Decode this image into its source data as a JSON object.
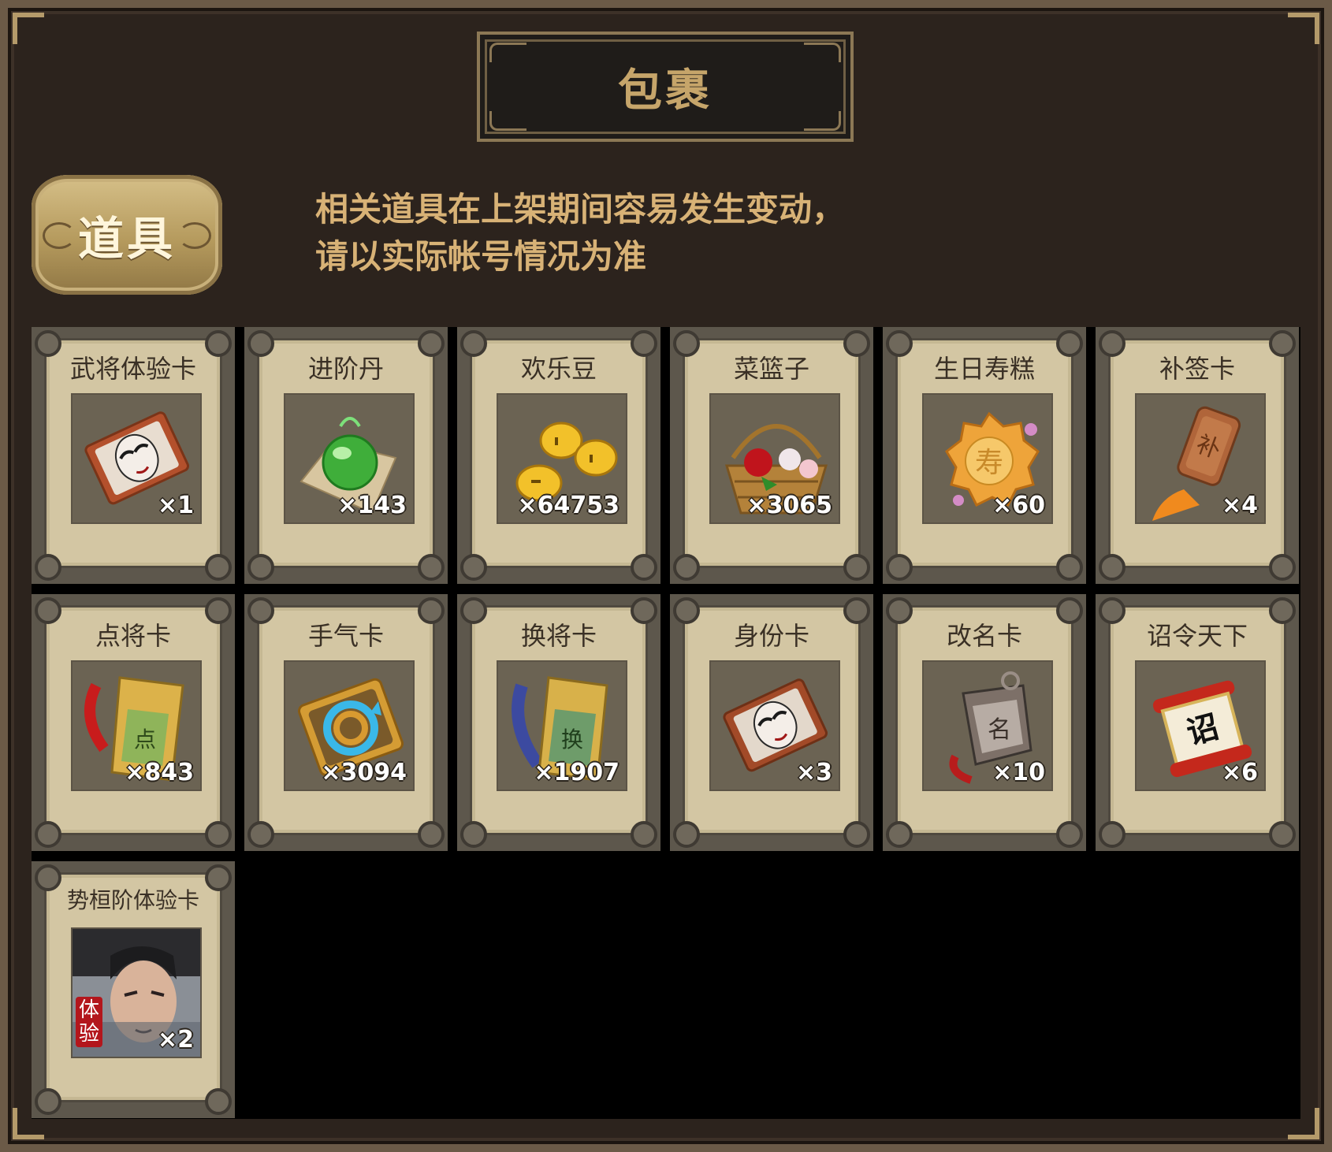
{
  "title": "包裹",
  "tab": {
    "label": "道具"
  },
  "notice": {
    "line1": "相关道具在上架期间容易发生变动，",
    "line2": "请以实际帐号情况为准"
  },
  "items": [
    {
      "name": "武将体验卡",
      "count": "×1",
      "icon": "opera-mask-card-icon"
    },
    {
      "name": "进阶丹",
      "count": "×143",
      "icon": "green-orb-icon"
    },
    {
      "name": "欢乐豆",
      "count": "×64753",
      "icon": "gold-beans-icon"
    },
    {
      "name": "菜篮子",
      "count": "×3065",
      "icon": "flower-basket-icon"
    },
    {
      "name": "生日寿糕",
      "count": "×60",
      "icon": "birthday-cake-icon"
    },
    {
      "name": "补签卡",
      "count": "×4",
      "icon": "sign-token-icon"
    },
    {
      "name": "点将卡",
      "count": "×843",
      "icon": "general-token-icon"
    },
    {
      "name": "手气卡",
      "count": "×3094",
      "icon": "refresh-card-icon"
    },
    {
      "name": "换将卡",
      "count": "×1907",
      "icon": "swap-token-icon"
    },
    {
      "name": "身份卡",
      "count": "×3",
      "icon": "identity-mask-card-icon"
    },
    {
      "name": "改名卡",
      "count": "×10",
      "icon": "rename-token-icon"
    },
    {
      "name": "诏令天下",
      "count": "×6",
      "icon": "edict-scroll-icon"
    },
    {
      "name": "势桓阶体验卡",
      "count": "×2",
      "icon": "hero-portrait-icon",
      "badge": "体验"
    }
  ]
}
